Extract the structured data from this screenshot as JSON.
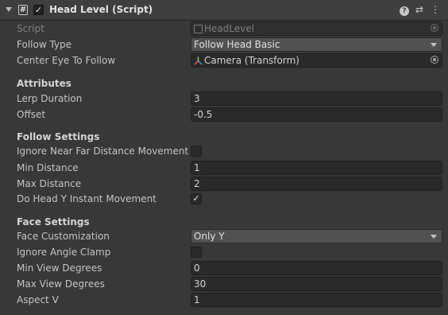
{
  "header": {
    "title": "Head Level (Script)",
    "script_icon": "#",
    "enabled_mark": "✓",
    "help_icon": "?",
    "presets_icon": "⇄",
    "menu_icon": "⋮"
  },
  "script": {
    "label": "Script",
    "value": "HeadLevel"
  },
  "follow_type": {
    "label": "Follow Type",
    "value": "Follow Head Basic"
  },
  "center_eye": {
    "label": "Center Eye To Follow",
    "value": "Camera (Transform)"
  },
  "attributes": {
    "title": "Attributes",
    "lerp_duration": {
      "label": "Lerp Duration",
      "value": "3"
    },
    "offset": {
      "label": "Offset",
      "value": "-0.5"
    }
  },
  "follow_settings": {
    "title": "Follow Settings",
    "ignore_near_far": {
      "label": "Ignore Near Far Distance Movement",
      "checked": false,
      "mark": ""
    },
    "min_distance": {
      "label": "Min Distance",
      "value": "1"
    },
    "max_distance": {
      "label": "Max Distance",
      "value": "2"
    },
    "head_y_instant": {
      "label": "Do Head Y Instant Movement",
      "checked": true,
      "mark": "✓"
    }
  },
  "face_settings": {
    "title": "Face Settings",
    "face_customization": {
      "label": "Face Customization",
      "value": "Only Y"
    },
    "ignore_angle_clamp": {
      "label": "Ignore Angle Clamp",
      "checked": false,
      "mark": ""
    },
    "min_view_degrees": {
      "label": "Min View Degrees",
      "value": "0"
    },
    "max_view_degrees": {
      "label": "Max View Degrees",
      "value": "30"
    },
    "aspect_v": {
      "label": "Aspect V",
      "value": "1"
    }
  }
}
